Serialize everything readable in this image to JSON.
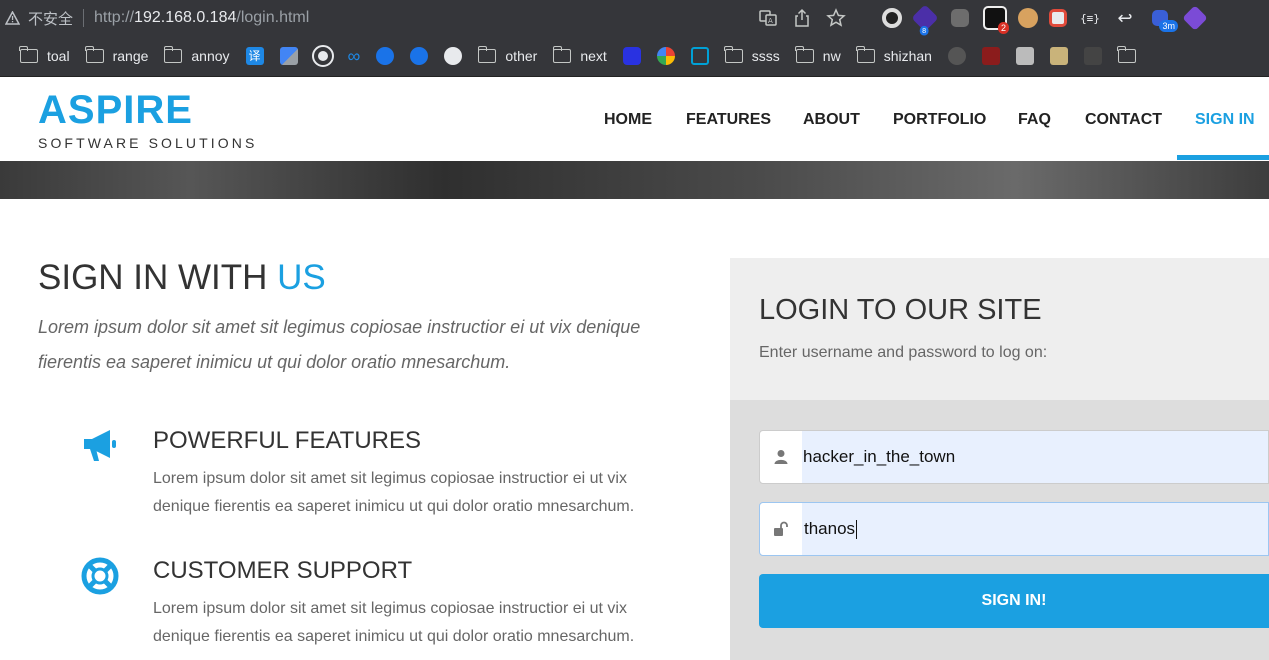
{
  "browser": {
    "security_label": "不安全",
    "url_prefix": "http://",
    "url_host": "192.168.0.184",
    "url_path": "/login.html",
    "extension_badges": [
      "8",
      "2",
      "3m"
    ]
  },
  "bookmarks": [
    {
      "type": "folder",
      "label": "toal"
    },
    {
      "type": "folder",
      "label": "range"
    },
    {
      "type": "folder",
      "label": "annoy"
    },
    {
      "type": "icon",
      "icon": "translate-icon"
    },
    {
      "type": "icon",
      "icon": "google-translate-icon"
    },
    {
      "type": "icon",
      "icon": "github-icon"
    },
    {
      "type": "icon",
      "icon": "cloud-icon"
    },
    {
      "type": "icon",
      "icon": "feather-icon"
    },
    {
      "type": "icon",
      "icon": "feather-icon"
    },
    {
      "type": "icon",
      "icon": "globe-icon"
    },
    {
      "type": "folder",
      "label": "other"
    },
    {
      "type": "folder",
      "label": "next"
    },
    {
      "type": "icon",
      "icon": "baidu-icon"
    },
    {
      "type": "icon",
      "icon": "google-icon"
    },
    {
      "type": "icon",
      "icon": "bilibili-icon"
    },
    {
      "type": "folder",
      "label": "ssss"
    },
    {
      "type": "folder",
      "label": "nw"
    },
    {
      "type": "folder",
      "label": "shizhan"
    }
  ],
  "site": {
    "logo_main": "ASPIRE",
    "logo_sub": "SOFTWARE SOLUTIONS",
    "nav": [
      "HOME",
      "FEATURES",
      "ABOUT",
      "PORTFOLIO",
      "FAQ",
      "CONTACT",
      "SIGN IN"
    ],
    "active_nav": "SIGN IN",
    "accent_color": "#1ba0e1"
  },
  "left": {
    "title_main": "SIGN IN WITH ",
    "title_accent": "US",
    "lead": "Lorem ipsum dolor sit amet sit legimus copiosae instructior ei ut vix denique fierentis ea saperet inimicu ut qui dolor oratio mnesarchum.",
    "features": [
      {
        "icon": "megaphone-icon",
        "title": "POWERFUL FEATURES",
        "text": "Lorem ipsum dolor sit amet sit legimus copiosae instructior ei ut vix denique fierentis ea saperet inimicu ut qui dolor oratio mnesarchum."
      },
      {
        "icon": "lifebuoy-icon",
        "title": "CUSTOMER SUPPORT",
        "text": "Lorem ipsum dolor sit amet sit legimus copiosae instructior ei ut vix denique fierentis ea saperet inimicu ut qui dolor oratio mnesarchum."
      }
    ]
  },
  "login": {
    "title": "LOGIN TO OUR SITE",
    "subtitle": "Enter username and password to log on:",
    "username_value": "hacker_in_the_town",
    "password_value": "thanos",
    "submit_label": "SIGN IN!"
  }
}
